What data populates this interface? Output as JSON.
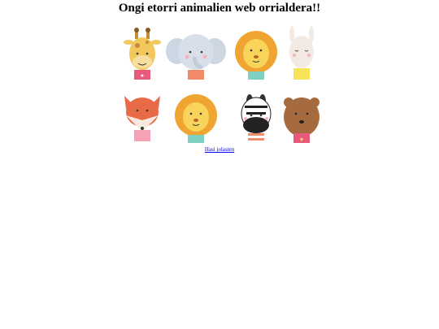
{
  "page": {
    "title": "Ongi etorri animalien web orrialdera!!",
    "start_link": "Hasi jolasten"
  },
  "animals_image": {
    "animals": [
      "giraffe",
      "elephant",
      "lion",
      "llama",
      "fox",
      "lion",
      "zebra",
      "bear"
    ]
  },
  "colors": {
    "link": "#0000ee",
    "giraffe": "#f2c75c",
    "elephant": "#d9dfe8",
    "lion_mane": "#f0a532",
    "lion_face": "#f8d55a",
    "llama": "#f3ebe3",
    "fox": "#e86a46",
    "zebra": "#ffffff",
    "bear": "#a56b3f"
  }
}
